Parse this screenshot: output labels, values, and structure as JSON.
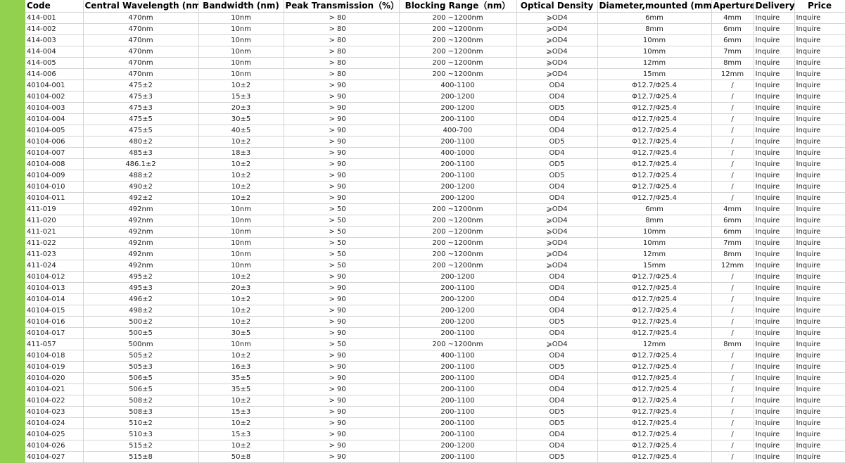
{
  "table": {
    "headers": [
      "Code",
      "Central Wavelength (nm)",
      "Bandwidth (nm)",
      "Peak Transmission（%）",
      "Blocking Range（nm）",
      "Optical Density",
      "Diameter,mounted (mm)",
      "Aperture",
      "Delivery",
      "Price"
    ],
    "rows": [
      [
        "414-001",
        "470nm",
        "10nm",
        "> 80",
        "200 ~1200nm",
        "⩾OD4",
        "6mm",
        "4mm",
        "Inquire",
        "Inquire"
      ],
      [
        "414-002",
        "470nm",
        "10nm",
        "> 80",
        "200 ~1200nm",
        "⩾OD4",
        "8mm",
        "6mm",
        "Inquire",
        "Inquire"
      ],
      [
        "414-003",
        "470nm",
        "10nm",
        "> 80",
        "200 ~1200nm",
        "⩾OD4",
        "10mm",
        "6mm",
        "Inquire",
        "Inquire"
      ],
      [
        "414-004",
        "470nm",
        "10nm",
        "> 80",
        "200 ~1200nm",
        "⩾OD4",
        "10mm",
        "7mm",
        "Inquire",
        "Inquire"
      ],
      [
        "414-005",
        "470nm",
        "10nm",
        "> 80",
        "200 ~1200nm",
        "⩾OD4",
        "12mm",
        "8mm",
        "Inquire",
        "Inquire"
      ],
      [
        "414-006",
        "470nm",
        "10nm",
        "> 80",
        "200 ~1200nm",
        "⩾OD4",
        "15mm",
        "12mm",
        "Inquire",
        "Inquire"
      ],
      [
        "40104-001",
        "475±2",
        "10±2",
        "> 90",
        "400-1100",
        "OD4",
        "Φ12.7/Φ25.4",
        "/",
        "Inquire",
        "Inquire"
      ],
      [
        "40104-002",
        "475±3",
        "15±3",
        "> 90",
        "200-1200",
        "OD4",
        "Φ12.7/Φ25.4",
        "/",
        "Inquire",
        "Inquire"
      ],
      [
        "40104-003",
        "475±3",
        "20±3",
        "> 90",
        "200-1200",
        "OD5",
        "Φ12.7/Φ25.4",
        "/",
        "Inquire",
        "Inquire"
      ],
      [
        "40104-004",
        "475±5",
        "30±5",
        "> 90",
        "200-1100",
        "OD4",
        "Φ12.7/Φ25.4",
        "/",
        "Inquire",
        "Inquire"
      ],
      [
        "40104-005",
        "475±5",
        "40±5",
        "> 90",
        "400-700",
        "OD4",
        "Φ12.7/Φ25.4",
        "/",
        "Inquire",
        "Inquire"
      ],
      [
        "40104-006",
        "480±2",
        "10±2",
        "> 90",
        "200-1100",
        "OD5",
        "Φ12.7/Φ25.4",
        "/",
        "Inquire",
        "Inquire"
      ],
      [
        "40104-007",
        "485±3",
        "18±3",
        "> 90",
        "400-1000",
        "OD4",
        "Φ12.7/Φ25.4",
        "/",
        "Inquire",
        "Inquire"
      ],
      [
        "40104-008",
        "486.1±2",
        "10±2",
        "> 90",
        "200-1100",
        "OD5",
        "Φ12.7/Φ25.4",
        "/",
        "Inquire",
        "Inquire"
      ],
      [
        "40104-009",
        "488±2",
        "10±2",
        "> 90",
        "200-1100",
        "OD5",
        "Φ12.7/Φ25.4",
        "/",
        "Inquire",
        "Inquire"
      ],
      [
        "40104-010",
        "490±2",
        "10±2",
        "> 90",
        "200-1200",
        "OD4",
        "Φ12.7/Φ25.4",
        "/",
        "Inquire",
        "Inquire"
      ],
      [
        "40104-011",
        "492±2",
        "10±2",
        "> 90",
        "200-1200",
        "OD4",
        "Φ12.7/Φ25.4",
        "/",
        "Inquire",
        "Inquire"
      ],
      [
        "411-019",
        "492nm",
        "10nm",
        "> 50",
        "200 ~1200nm",
        "⩾OD4",
        "6mm",
        "4mm",
        "Inquire",
        "Inquire"
      ],
      [
        "411-020",
        "492nm",
        "10nm",
        "> 50",
        "200 ~1200nm",
        "⩾OD4",
        "8mm",
        "6mm",
        "Inquire",
        "Inquire"
      ],
      [
        "411-021",
        "492nm",
        "10nm",
        "> 50",
        "200 ~1200nm",
        "⩾OD4",
        "10mm",
        "6mm",
        "Inquire",
        "Inquire"
      ],
      [
        "411-022",
        "492nm",
        "10nm",
        "> 50",
        "200 ~1200nm",
        "⩾OD4",
        "10mm",
        "7mm",
        "Inquire",
        "Inquire"
      ],
      [
        "411-023",
        "492nm",
        "10nm",
        "> 50",
        "200 ~1200nm",
        "⩾OD4",
        "12mm",
        "8mm",
        "Inquire",
        "Inquire"
      ],
      [
        "411-024",
        "492nm",
        "10nm",
        "> 50",
        "200 ~1200nm",
        "⩾OD4",
        "15mm",
        "12mm",
        "Inquire",
        "Inquire"
      ],
      [
        "40104-012",
        "495±2",
        "10±2",
        "> 90",
        "200-1200",
        "OD4",
        "Φ12.7/Φ25.4",
        "/",
        "Inquire",
        "Inquire"
      ],
      [
        "40104-013",
        "495±3",
        "20±3",
        "> 90",
        "200-1100",
        "OD4",
        "Φ12.7/Φ25.4",
        "/",
        "Inquire",
        "Inquire"
      ],
      [
        "40104-014",
        "496±2",
        "10±2",
        "> 90",
        "200-1200",
        "OD4",
        "Φ12.7/Φ25.4",
        "/",
        "Inquire",
        "Inquire"
      ],
      [
        "40104-015",
        "498±2",
        "10±2",
        "> 90",
        "200-1200",
        "OD4",
        "Φ12.7/Φ25.4",
        "/",
        "Inquire",
        "Inquire"
      ],
      [
        "40104-016",
        "500±2",
        "10±2",
        "> 90",
        "200-1200",
        "OD5",
        "Φ12.7/Φ25.4",
        "/",
        "Inquire",
        "Inquire"
      ],
      [
        "40104-017",
        "500±5",
        "30±5",
        "> 90",
        "200-1100",
        "OD4",
        "Φ12.7/Φ25.4",
        "/",
        "Inquire",
        "Inquire"
      ],
      [
        "411-057",
        "500nm",
        "10nm",
        "> 50",
        "200 ~1200nm",
        "⩾OD4",
        "12mm",
        "8mm",
        "Inquire",
        "Inquire"
      ],
      [
        "40104-018",
        "505±2",
        "10±2",
        "> 90",
        "400-1100",
        "OD4",
        "Φ12.7/Φ25.4",
        "/",
        "Inquire",
        "Inquire"
      ],
      [
        "40104-019",
        "505±3",
        "16±3",
        "> 90",
        "200-1100",
        "OD5",
        "Φ12.7/Φ25.4",
        "/",
        "Inquire",
        "Inquire"
      ],
      [
        "40104-020",
        "506±5",
        "35±5",
        "> 90",
        "200-1100",
        "OD4",
        "Φ12.7/Φ25.4",
        "/",
        "Inquire",
        "Inquire"
      ],
      [
        "40104-021",
        "506±5",
        "35±5",
        "> 90",
        "200-1100",
        "OD4",
        "Φ12.7/Φ25.4",
        "/",
        "Inquire",
        "Inquire"
      ],
      [
        "40104-022",
        "508±2",
        "10±2",
        "> 90",
        "200-1100",
        "OD4",
        "Φ12.7/Φ25.4",
        "/",
        "Inquire",
        "Inquire"
      ],
      [
        "40104-023",
        "508±3",
        "15±3",
        "> 90",
        "200-1100",
        "OD5",
        "Φ12.7/Φ25.4",
        "/",
        "Inquire",
        "Inquire"
      ],
      [
        "40104-024",
        "510±2",
        "10±2",
        "> 90",
        "200-1100",
        "OD5",
        "Φ12.7/Φ25.4",
        "/",
        "Inquire",
        "Inquire"
      ],
      [
        "40104-025",
        "510±3",
        "15±3",
        "> 90",
        "200-1100",
        "OD4",
        "Φ12.7/Φ25.4",
        "/",
        "Inquire",
        "Inquire"
      ],
      [
        "40104-026",
        "515±2",
        "10±2",
        "> 90",
        "200-1200",
        "OD4",
        "Φ12.7/Φ25.4",
        "/",
        "Inquire",
        "Inquire"
      ],
      [
        "40104-027",
        "515±8",
        "50±8",
        "> 90",
        "200-1100",
        "OD5",
        "Φ12.7/Φ25.4",
        "/",
        "Inquire",
        "Inquire"
      ]
    ]
  },
  "colors": {
    "accent_bar": "#92d050",
    "grid_line": "#d4d4d4"
  }
}
